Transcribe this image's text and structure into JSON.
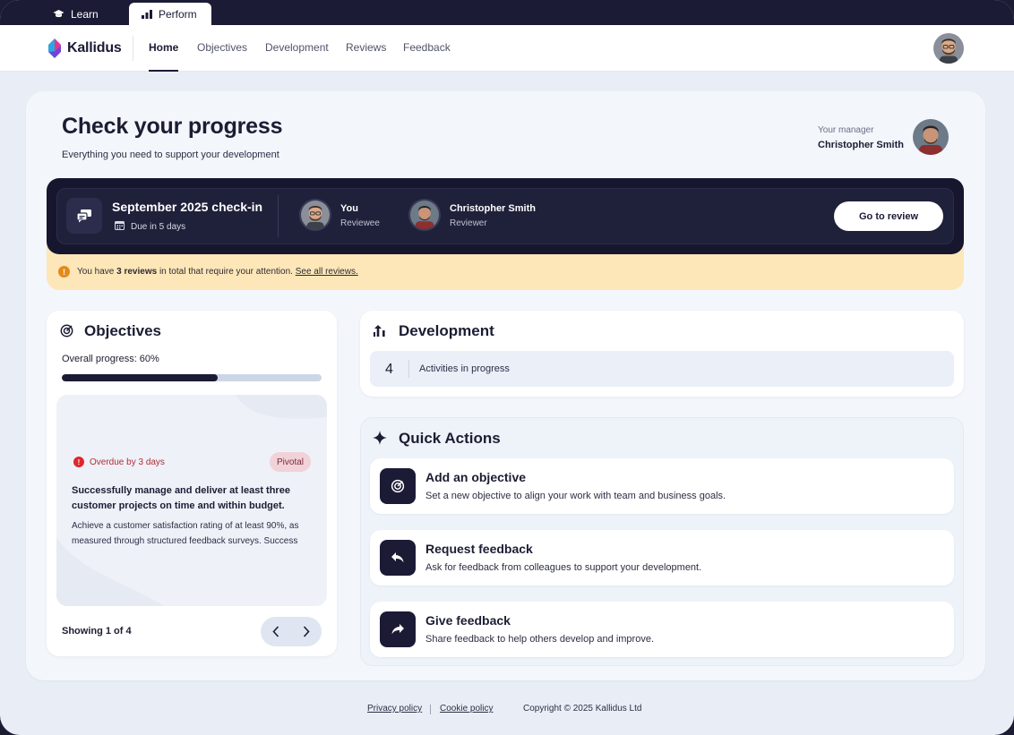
{
  "product_tabs": [
    {
      "label": "Learn",
      "icon": "graduation-cap-icon"
    },
    {
      "label": "Perform",
      "icon": "bar-chart-icon",
      "active": true
    }
  ],
  "nav": {
    "brand": "Kallidus",
    "links": [
      "Home",
      "Objectives",
      "Development",
      "Reviews",
      "Feedback"
    ],
    "active": "Home"
  },
  "header": {
    "title": "Check your progress",
    "subtitle": "Everything you need to support your development",
    "manager_label": "Your manager",
    "manager_name": "Christopher Smith"
  },
  "checkin": {
    "title": "September 2025 check-in",
    "due": "Due in 5 days",
    "reviewee_name": "You",
    "reviewee_role": "Reviewee",
    "reviewer_name": "Christopher Smith",
    "reviewer_role": "Reviewer",
    "button": "Go to review"
  },
  "alert": {
    "prefix": "You have ",
    "emphasis": "3 reviews",
    "suffix": " in total that require your attention. ",
    "link": "See all reviews."
  },
  "objectives": {
    "title": "Objectives",
    "progress_label": "Overall progress: 60%",
    "progress": 0.6,
    "item": {
      "status": "Overdue by 3 days",
      "tag": "Pivotal",
      "title": "Successfully manage and deliver at least three customer projects on time and within budget.",
      "description": "Achieve a customer satisfaction rating of at least 90%, as measured through structured feedback surveys. Success in..."
    },
    "showing": "Showing 1 of 4"
  },
  "development": {
    "title": "Development",
    "count": "4",
    "label": "Activities in progress"
  },
  "quick_actions": {
    "title": "Quick Actions",
    "items": [
      {
        "title": "Add an objective",
        "description": "Set a new objective to align your work with team and business goals.",
        "icon": "target-icon"
      },
      {
        "title": "Request feedback",
        "description": "Ask for feedback from colleagues to support your development.",
        "icon": "reply-arrow-icon"
      },
      {
        "title": "Give feedback",
        "description": "Share feedback to help others develop and improve.",
        "icon": "forward-arrow-icon"
      }
    ]
  },
  "footer": {
    "privacy": "Privacy policy",
    "cookie": "Cookie policy",
    "copyright": "Copyright © 2025 Kallidus Ltd"
  },
  "colors": {
    "navy": "#1b1b36",
    "alert_bg": "#fde7b8",
    "overdue": "#e0262f",
    "tag_bg": "#f1d2d8"
  }
}
